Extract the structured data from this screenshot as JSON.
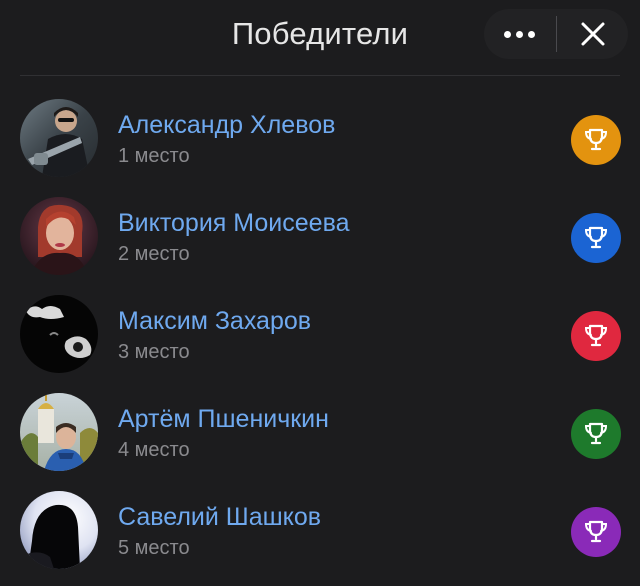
{
  "header": {
    "title": "Победители",
    "more_icon": "more-horizontal-icon",
    "close_icon": "close-icon"
  },
  "winners": [
    {
      "name": "Александр Хлевов",
      "place": "1 место",
      "trophy_color": "#e3930f",
      "avatar": "photo-man-with-guitar"
    },
    {
      "name": "Виктория Моисеева",
      "place": "2 место",
      "trophy_color": "#1b64d3",
      "avatar": "photo-woman-red-hair"
    },
    {
      "name": "Максим Захаров",
      "place": "3 место",
      "trophy_color": "#e0283f",
      "avatar": "photo-dark-monochrome"
    },
    {
      "name": "Артём Пшеничкин",
      "place": "4 место",
      "trophy_color": "#1e7a2c",
      "avatar": "photo-boy-church-background"
    },
    {
      "name": "Савелий Шашков",
      "place": "5 место",
      "trophy_color": "#8a2ab8",
      "avatar": "photo-silhouette-hood"
    }
  ],
  "colors": {
    "background": "#1c1c1e",
    "name_link": "#6fa9ef",
    "secondary_text": "#8a8a8e"
  }
}
